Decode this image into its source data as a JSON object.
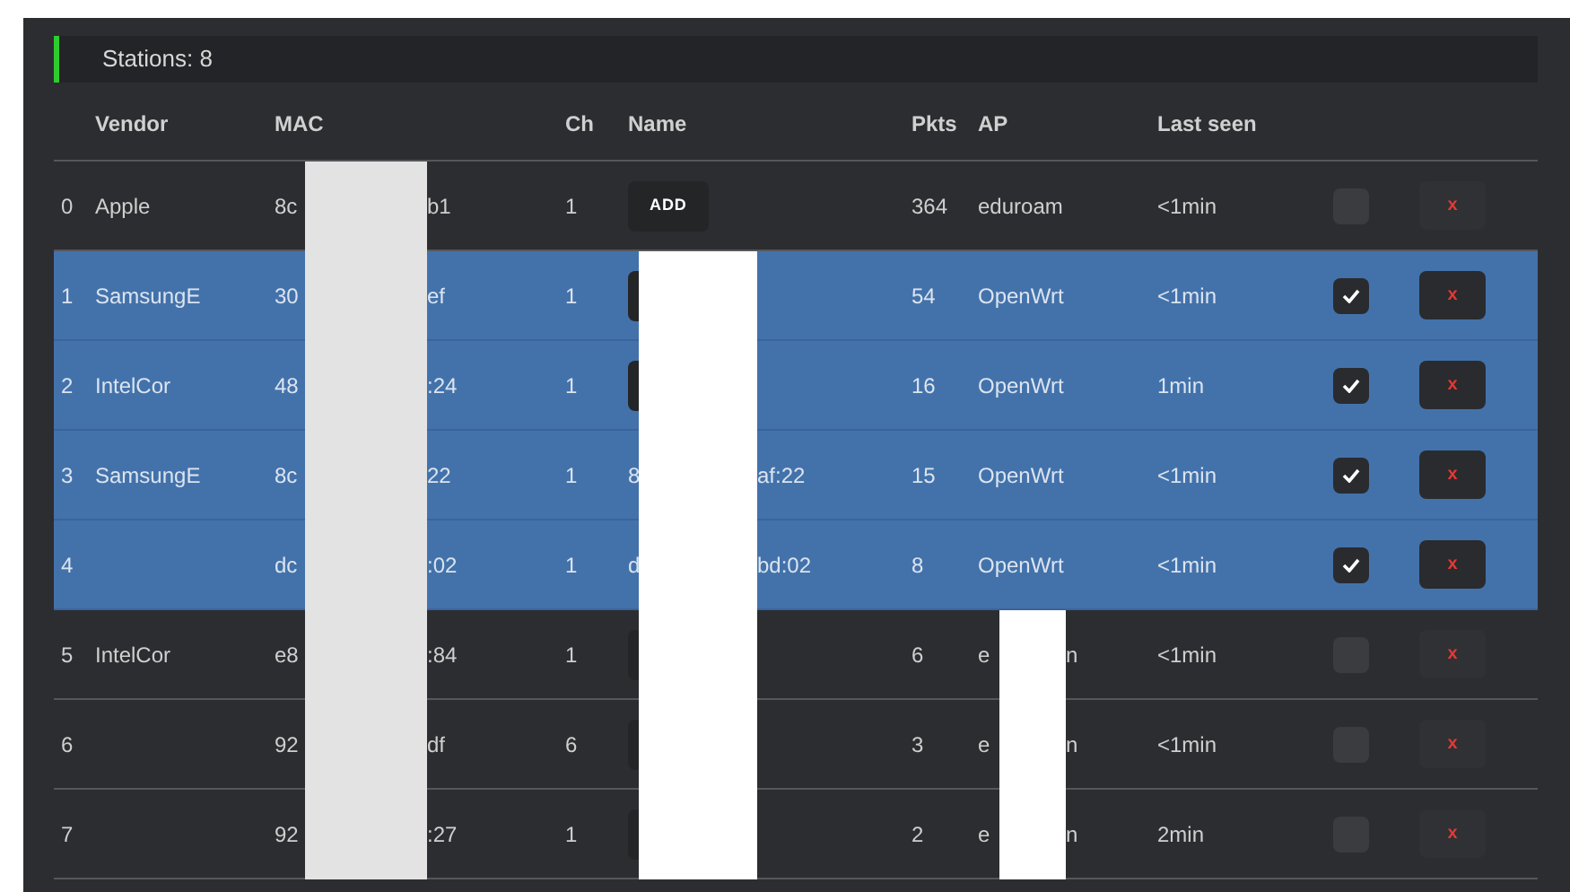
{
  "header": {
    "title": "Stations: 8"
  },
  "table": {
    "columns": [
      "Vendor",
      "MAC",
      "Ch",
      "Name",
      "Pkts",
      "AP",
      "Last seen"
    ],
    "rows": [
      {
        "index": "0",
        "vendor": "Apple",
        "mac": {
          "start": "8c",
          "end": "b1"
        },
        "ch": "1",
        "name": {
          "kind": "button",
          "label": "ADD"
        },
        "pkts": "364",
        "ap": "eduroam",
        "last_seen": "<1min",
        "selected": false,
        "checked": false,
        "delete": "x"
      },
      {
        "index": "1",
        "vendor": "SamsungE",
        "mac": {
          "start": "30",
          "end": "ef"
        },
        "ch": "1",
        "name": {
          "kind": "button"
        },
        "pkts": "54",
        "ap": "OpenWrt",
        "last_seen": "<1min",
        "selected": true,
        "checked": true,
        "delete": "x"
      },
      {
        "index": "2",
        "vendor": "IntelCor",
        "mac": {
          "start": "48",
          "end": ":24"
        },
        "ch": "1",
        "name": {
          "kind": "button"
        },
        "pkts": "16",
        "ap": "OpenWrt",
        "last_seen": "1min",
        "selected": true,
        "checked": true,
        "delete": "x"
      },
      {
        "index": "3",
        "vendor": "SamsungE",
        "mac": {
          "start": "8c",
          "end": "22"
        },
        "ch": "1",
        "name": {
          "kind": "text",
          "start": "8",
          "end": "af:22"
        },
        "pkts": "15",
        "ap": "OpenWrt",
        "last_seen": "<1min",
        "selected": true,
        "checked": true,
        "delete": "x"
      },
      {
        "index": "4",
        "mac": {
          "start": "dc",
          "end": ":02"
        },
        "ch": "1",
        "name": {
          "kind": "text",
          "start": "d",
          "end": "bd:02"
        },
        "pkts": "8",
        "ap": "OpenWrt",
        "last_seen": "<1min",
        "selected": true,
        "checked": true,
        "delete": "x"
      },
      {
        "index": "5",
        "vendor": "IntelCor",
        "mac": {
          "start": "e8",
          "end": ":84"
        },
        "ch": "1",
        "name": {
          "kind": "button"
        },
        "pkts": "6",
        "ap": {
          "start": "e",
          "end": "n"
        },
        "last_seen": "<1min",
        "selected": false,
        "checked": false,
        "delete": "x"
      },
      {
        "index": "6",
        "mac": {
          "start": "92",
          "end": "df"
        },
        "ch": "6",
        "name": {
          "kind": "button"
        },
        "pkts": "3",
        "ap": {
          "start": "e",
          "end": "n"
        },
        "last_seen": "<1min",
        "selected": false,
        "checked": false,
        "delete": "x"
      },
      {
        "index": "7",
        "mac": {
          "start": "92",
          "end": ":27"
        },
        "ch": "1",
        "name": {
          "kind": "button"
        },
        "pkts": "2",
        "ap": {
          "start": "e",
          "end": "n"
        },
        "last_seen": "2min",
        "selected": false,
        "checked": false,
        "delete": "x"
      }
    ]
  }
}
